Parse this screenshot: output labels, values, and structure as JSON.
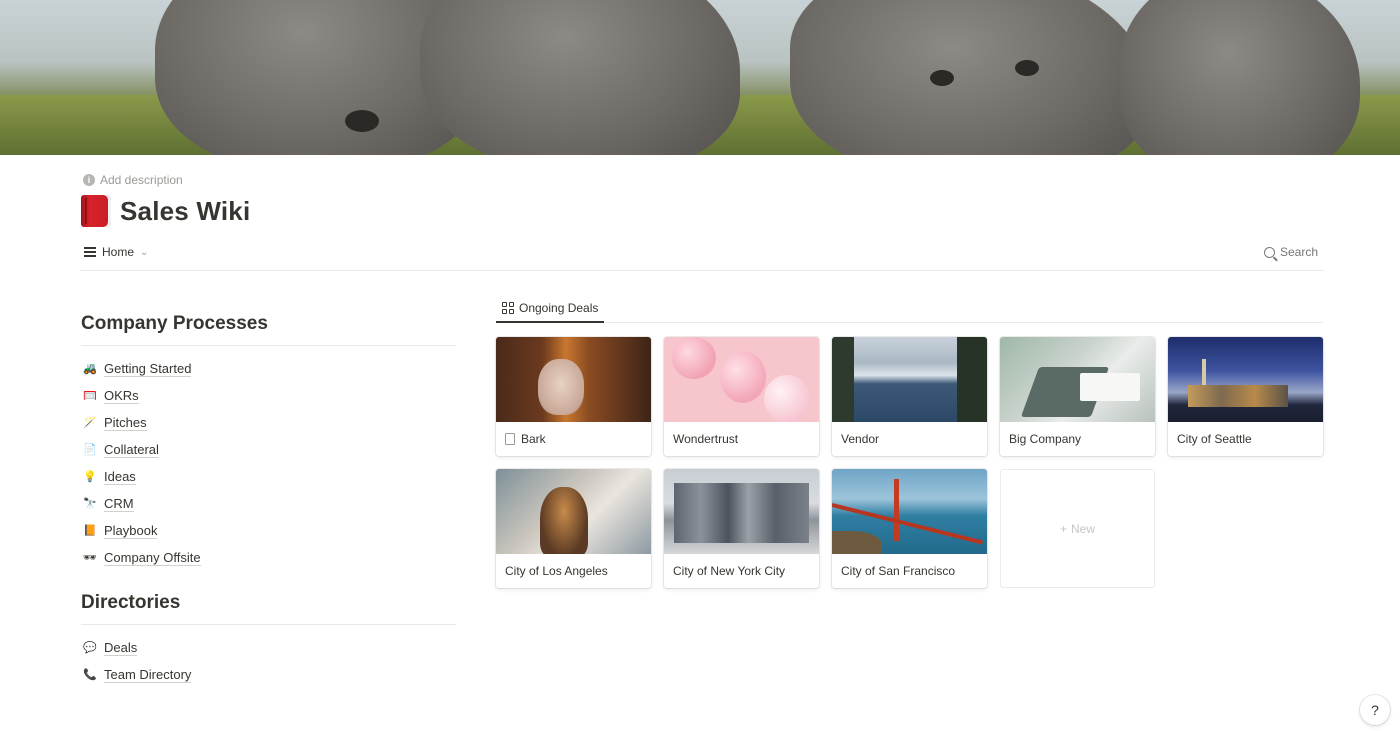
{
  "page": {
    "add_description": "Add description",
    "title": "Sales Wiki"
  },
  "viewbar": {
    "current_view": "Home",
    "search_label": "Search"
  },
  "sections": [
    {
      "heading": "Company Processes",
      "items": [
        {
          "label": "Getting Started",
          "icon": "tractor-icon"
        },
        {
          "label": "OKRs",
          "icon": "goal-net-icon"
        },
        {
          "label": "Pitches",
          "icon": "magic-wand-icon"
        },
        {
          "label": "Collateral",
          "icon": "document-icon"
        },
        {
          "label": "Ideas",
          "icon": "lightbulb-icon"
        },
        {
          "label": "CRM",
          "icon": "telescope-icon"
        },
        {
          "label": "Playbook",
          "icon": "book-icon"
        },
        {
          "label": "Company Offsite",
          "icon": "sunglasses-icon"
        }
      ]
    },
    {
      "heading": "Directories",
      "items": [
        {
          "label": "Deals",
          "icon": "speech-bubble-icon"
        },
        {
          "label": "Team Directory",
          "icon": "telephone-icon"
        }
      ]
    }
  ],
  "gallery": {
    "tab_label": "Ongoing Deals",
    "cards": [
      {
        "title": "Bark"
      },
      {
        "title": "Wondertrust"
      },
      {
        "title": "Vendor"
      },
      {
        "title": "Big Company"
      },
      {
        "title": "City of Seattle"
      },
      {
        "title": "City of Los Angeles"
      },
      {
        "title": "City of New York City"
      },
      {
        "title": "City of San Francisco"
      }
    ],
    "new_label": "New"
  },
  "help_label": "?"
}
